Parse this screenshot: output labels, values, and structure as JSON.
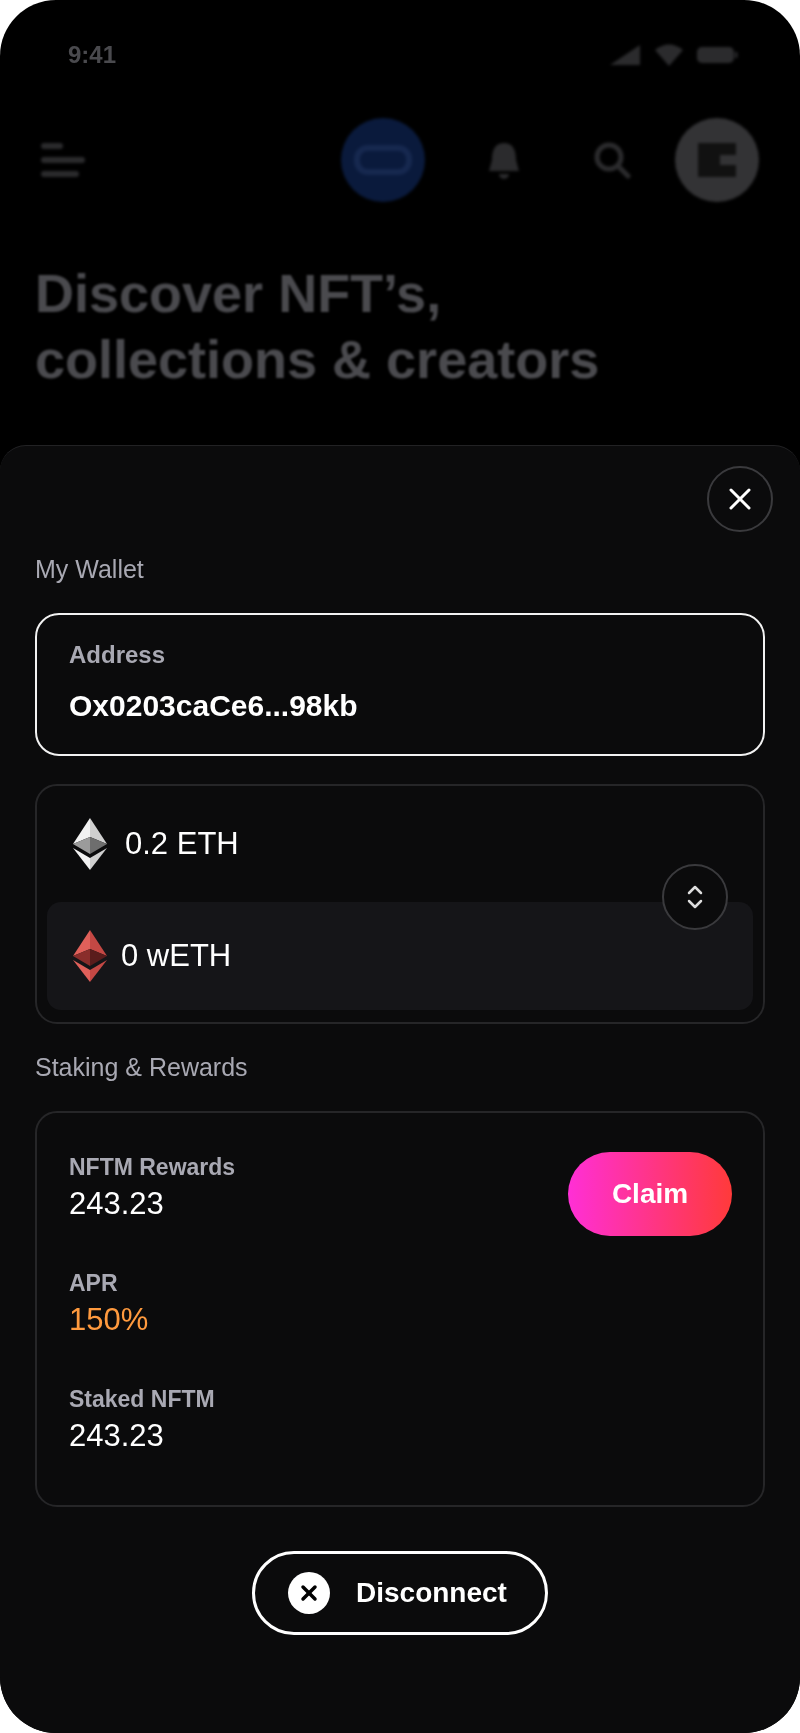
{
  "status_bar": {
    "time": "9:41"
  },
  "header": {
    "title_lines": [
      "Discover NFT’s,",
      "collections & creators"
    ]
  },
  "wallet": {
    "title": "My Wallet",
    "address": {
      "label": "Address",
      "value": "Ox0203caCe6...98kb"
    },
    "balances": [
      {
        "kind": "eth",
        "amount": "0.2 ETH"
      },
      {
        "kind": "weth",
        "amount": "0 wETH"
      }
    ]
  },
  "staking": {
    "title": "Staking & Rewards",
    "stats": [
      {
        "label": "NFTM Rewards",
        "value": "243.23",
        "color": "#ffffff"
      },
      {
        "label": "APR",
        "value": "150%",
        "color": "#ff9a3e"
      },
      {
        "label": "Staked NFTM",
        "value": "243.23",
        "color": "#ffffff"
      }
    ],
    "claim_button": "Claim"
  },
  "disconnect_button": "Disconnect"
}
